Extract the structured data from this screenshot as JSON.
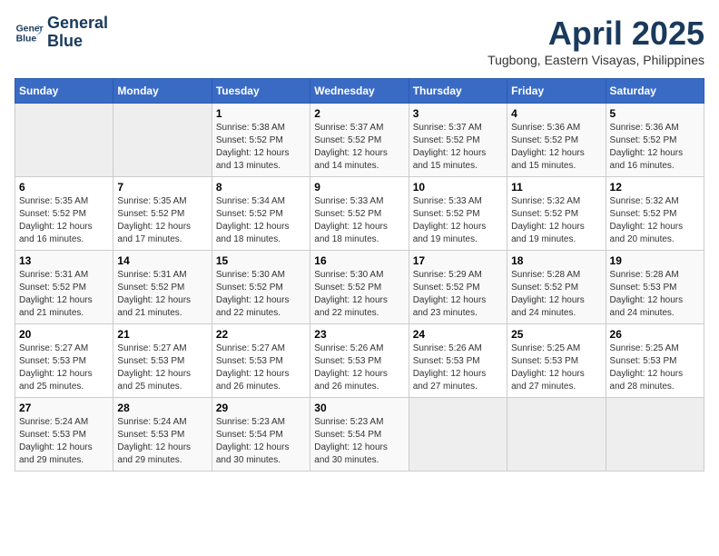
{
  "logo": {
    "line1": "General",
    "line2": "Blue"
  },
  "title": "April 2025",
  "location": "Tugbong, Eastern Visayas, Philippines",
  "weekdays": [
    "Sunday",
    "Monday",
    "Tuesday",
    "Wednesday",
    "Thursday",
    "Friday",
    "Saturday"
  ],
  "weeks": [
    [
      null,
      null,
      {
        "day": "1",
        "sunrise": "Sunrise: 5:38 AM",
        "sunset": "Sunset: 5:52 PM",
        "daylight": "Daylight: 12 hours and 13 minutes."
      },
      {
        "day": "2",
        "sunrise": "Sunrise: 5:37 AM",
        "sunset": "Sunset: 5:52 PM",
        "daylight": "Daylight: 12 hours and 14 minutes."
      },
      {
        "day": "3",
        "sunrise": "Sunrise: 5:37 AM",
        "sunset": "Sunset: 5:52 PM",
        "daylight": "Daylight: 12 hours and 15 minutes."
      },
      {
        "day": "4",
        "sunrise": "Sunrise: 5:36 AM",
        "sunset": "Sunset: 5:52 PM",
        "daylight": "Daylight: 12 hours and 15 minutes."
      },
      {
        "day": "5",
        "sunrise": "Sunrise: 5:36 AM",
        "sunset": "Sunset: 5:52 PM",
        "daylight": "Daylight: 12 hours and 16 minutes."
      }
    ],
    [
      {
        "day": "6",
        "sunrise": "Sunrise: 5:35 AM",
        "sunset": "Sunset: 5:52 PM",
        "daylight": "Daylight: 12 hours and 16 minutes."
      },
      {
        "day": "7",
        "sunrise": "Sunrise: 5:35 AM",
        "sunset": "Sunset: 5:52 PM",
        "daylight": "Daylight: 12 hours and 17 minutes."
      },
      {
        "day": "8",
        "sunrise": "Sunrise: 5:34 AM",
        "sunset": "Sunset: 5:52 PM",
        "daylight": "Daylight: 12 hours and 18 minutes."
      },
      {
        "day": "9",
        "sunrise": "Sunrise: 5:33 AM",
        "sunset": "Sunset: 5:52 PM",
        "daylight": "Daylight: 12 hours and 18 minutes."
      },
      {
        "day": "10",
        "sunrise": "Sunrise: 5:33 AM",
        "sunset": "Sunset: 5:52 PM",
        "daylight": "Daylight: 12 hours and 19 minutes."
      },
      {
        "day": "11",
        "sunrise": "Sunrise: 5:32 AM",
        "sunset": "Sunset: 5:52 PM",
        "daylight": "Daylight: 12 hours and 19 minutes."
      },
      {
        "day": "12",
        "sunrise": "Sunrise: 5:32 AM",
        "sunset": "Sunset: 5:52 PM",
        "daylight": "Daylight: 12 hours and 20 minutes."
      }
    ],
    [
      {
        "day": "13",
        "sunrise": "Sunrise: 5:31 AM",
        "sunset": "Sunset: 5:52 PM",
        "daylight": "Daylight: 12 hours and 21 minutes."
      },
      {
        "day": "14",
        "sunrise": "Sunrise: 5:31 AM",
        "sunset": "Sunset: 5:52 PM",
        "daylight": "Daylight: 12 hours and 21 minutes."
      },
      {
        "day": "15",
        "sunrise": "Sunrise: 5:30 AM",
        "sunset": "Sunset: 5:52 PM",
        "daylight": "Daylight: 12 hours and 22 minutes."
      },
      {
        "day": "16",
        "sunrise": "Sunrise: 5:30 AM",
        "sunset": "Sunset: 5:52 PM",
        "daylight": "Daylight: 12 hours and 22 minutes."
      },
      {
        "day": "17",
        "sunrise": "Sunrise: 5:29 AM",
        "sunset": "Sunset: 5:52 PM",
        "daylight": "Daylight: 12 hours and 23 minutes."
      },
      {
        "day": "18",
        "sunrise": "Sunrise: 5:28 AM",
        "sunset": "Sunset: 5:52 PM",
        "daylight": "Daylight: 12 hours and 24 minutes."
      },
      {
        "day": "19",
        "sunrise": "Sunrise: 5:28 AM",
        "sunset": "Sunset: 5:53 PM",
        "daylight": "Daylight: 12 hours and 24 minutes."
      }
    ],
    [
      {
        "day": "20",
        "sunrise": "Sunrise: 5:27 AM",
        "sunset": "Sunset: 5:53 PM",
        "daylight": "Daylight: 12 hours and 25 minutes."
      },
      {
        "day": "21",
        "sunrise": "Sunrise: 5:27 AM",
        "sunset": "Sunset: 5:53 PM",
        "daylight": "Daylight: 12 hours and 25 minutes."
      },
      {
        "day": "22",
        "sunrise": "Sunrise: 5:27 AM",
        "sunset": "Sunset: 5:53 PM",
        "daylight": "Daylight: 12 hours and 26 minutes."
      },
      {
        "day": "23",
        "sunrise": "Sunrise: 5:26 AM",
        "sunset": "Sunset: 5:53 PM",
        "daylight": "Daylight: 12 hours and 26 minutes."
      },
      {
        "day": "24",
        "sunrise": "Sunrise: 5:26 AM",
        "sunset": "Sunset: 5:53 PM",
        "daylight": "Daylight: 12 hours and 27 minutes."
      },
      {
        "day": "25",
        "sunrise": "Sunrise: 5:25 AM",
        "sunset": "Sunset: 5:53 PM",
        "daylight": "Daylight: 12 hours and 27 minutes."
      },
      {
        "day": "26",
        "sunrise": "Sunrise: 5:25 AM",
        "sunset": "Sunset: 5:53 PM",
        "daylight": "Daylight: 12 hours and 28 minutes."
      }
    ],
    [
      {
        "day": "27",
        "sunrise": "Sunrise: 5:24 AM",
        "sunset": "Sunset: 5:53 PM",
        "daylight": "Daylight: 12 hours and 29 minutes."
      },
      {
        "day": "28",
        "sunrise": "Sunrise: 5:24 AM",
        "sunset": "Sunset: 5:53 PM",
        "daylight": "Daylight: 12 hours and 29 minutes."
      },
      {
        "day": "29",
        "sunrise": "Sunrise: 5:23 AM",
        "sunset": "Sunset: 5:54 PM",
        "daylight": "Daylight: 12 hours and 30 minutes."
      },
      {
        "day": "30",
        "sunrise": "Sunrise: 5:23 AM",
        "sunset": "Sunset: 5:54 PM",
        "daylight": "Daylight: 12 hours and 30 minutes."
      },
      null,
      null,
      null
    ]
  ]
}
